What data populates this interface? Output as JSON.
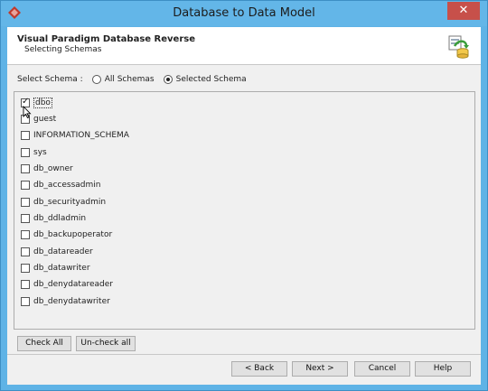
{
  "window": {
    "title": "Database to Data Model",
    "close_glyph": "✕"
  },
  "header": {
    "title": "Visual Paradigm Database Reverse",
    "subtitle": "Selecting Schemas",
    "icon": "database-wizard-icon"
  },
  "schema_select": {
    "label": "Select Schema :",
    "options": [
      {
        "label": "All Schemas",
        "selected": false
      },
      {
        "label": "Selected Schema",
        "selected": true
      }
    ]
  },
  "schemas": [
    {
      "label": "dbo",
      "checked": true
    },
    {
      "label": "guest",
      "checked": false
    },
    {
      "label": "INFORMATION_SCHEMA",
      "checked": false
    },
    {
      "label": "sys",
      "checked": false
    },
    {
      "label": "db_owner",
      "checked": false
    },
    {
      "label": "db_accessadmin",
      "checked": false
    },
    {
      "label": "db_securityadmin",
      "checked": false
    },
    {
      "label": "db_ddladmin",
      "checked": false
    },
    {
      "label": "db_backupoperator",
      "checked": false
    },
    {
      "label": "db_datareader",
      "checked": false
    },
    {
      "label": "db_datawriter",
      "checked": false
    },
    {
      "label": "db_denydatareader",
      "checked": false
    },
    {
      "label": "db_denydatawriter",
      "checked": false
    }
  ],
  "list_buttons": {
    "check_all": "Check All",
    "uncheck_all": "Un-check all"
  },
  "nav_buttons": {
    "back": "< Back",
    "next": "Next >",
    "cancel": "Cancel",
    "help": "Help"
  }
}
